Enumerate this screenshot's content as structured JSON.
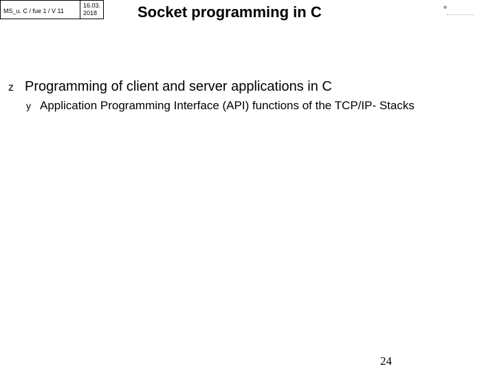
{
  "header": {
    "doc_ref": "MS_u. C / fue 1 / V 11",
    "date_top": "16.03.",
    "date_bottom": "2018"
  },
  "title": "Socket programming in C",
  "content": {
    "main_bullet_glyph": "z",
    "main_bullet_text": "Programming of client and server applications in C",
    "sub_bullet_glyph": "y",
    "sub_bullet_text": "Application Programming Interface (API) functions of the TCP/IP- Stacks"
  },
  "page_number": "24"
}
